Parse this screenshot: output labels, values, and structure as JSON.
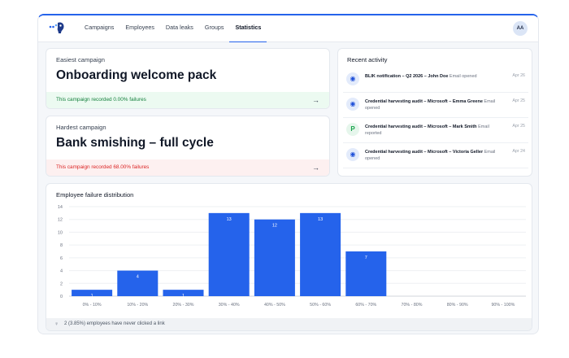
{
  "nav": {
    "items": [
      {
        "label": "Campaigns",
        "active": false
      },
      {
        "label": "Employees",
        "active": false
      },
      {
        "label": "Data leaks",
        "active": false
      },
      {
        "label": "Groups",
        "active": false
      },
      {
        "label": "Statistics",
        "active": true
      }
    ],
    "avatar": "AA"
  },
  "easiest": {
    "label": "Easiest campaign",
    "title": "Onboarding welcome pack",
    "footer": "This campaign recorded 0.00% failures",
    "accent": "#15803d"
  },
  "hardest": {
    "label": "Hardest campaign",
    "title": "Bank smishing – full cycle",
    "footer": "This campaign recorded 68.00% failures",
    "accent": "#dc2626"
  },
  "recent": {
    "title": "Recent activity",
    "items": [
      {
        "icon": "eye-icon",
        "title": "BLIK notification – Q2 2026 – John Doe",
        "action": "Email opened",
        "date": "Apr 26"
      },
      {
        "icon": "eye-icon",
        "title": "Credential harvesting audit – Microsoft – Emma Greene",
        "action": "Email opened",
        "date": "Apr 25"
      },
      {
        "icon": "reported-icon",
        "glyph": "P",
        "title": "Credential harvesting audit – Microsoft – Mark Smith",
        "action": "Email reported",
        "date": "Apr 25"
      },
      {
        "icon": "eye-icon",
        "title": "Credential harvesting audit – Microsoft – Victoria Geller",
        "action": "Email opened",
        "date": "Apr 24"
      }
    ]
  },
  "chart": {
    "title": "Employee failure distribution",
    "footer": "2 (3.85%) employees have never clicked a link"
  },
  "chart_data": {
    "type": "bar",
    "title": "Employee failure distribution",
    "categories": [
      "0% - 10%",
      "10% - 20%",
      "20% - 30%",
      "30% - 40%",
      "40% - 50%",
      "50% - 60%",
      "60% - 70%",
      "70% - 80%",
      "80% - 90%",
      "90% - 100%"
    ],
    "values": [
      1,
      4,
      1,
      13,
      12,
      13,
      7,
      0,
      0,
      0
    ],
    "yticks": [
      0,
      2,
      4,
      6,
      8,
      10,
      12,
      14
    ],
    "ylim": [
      0,
      14
    ],
    "bar_color": "#2563eb",
    "grid": true
  },
  "colors": {
    "brand": "#2563eb"
  }
}
